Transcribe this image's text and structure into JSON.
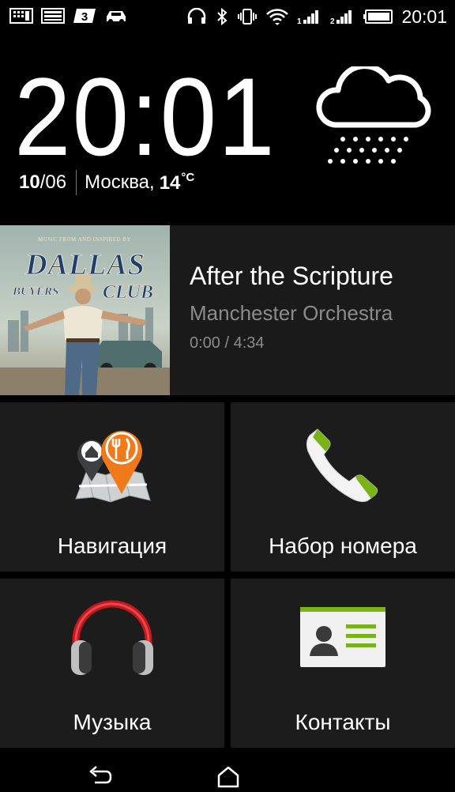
{
  "status_bar": {
    "left_icons": [
      "gallery-notification-icon",
      "image-notification-icon",
      "3g-app-icon",
      "car-mode-icon"
    ],
    "right_icons": [
      "headset-icon",
      "bluetooth-icon",
      "vibrate-icon",
      "wifi-icon",
      "signal-1-icon",
      "signal-2-icon",
      "battery-icon"
    ],
    "time": "20:01"
  },
  "clock_widget": {
    "time": "20:01",
    "date_day": "10",
    "date_rest": "/06",
    "city": "Москва,",
    "temperature": "14",
    "temp_unit": "°C",
    "weather_icon": "rain-cloud-icon"
  },
  "music": {
    "album_art": {
      "line1": "MUSIC FROM AND INSPIRED BY",
      "line2": "DALLAS",
      "line3": "BUYERS",
      "line4": "CLUB"
    },
    "title": "After the Scripture",
    "artist": "Manchester Orchestra",
    "progress_text": "0:00 / 4:34",
    "progress_fraction": 0
  },
  "tiles": [
    {
      "label": "Навигация",
      "icon": "map-pins-icon"
    },
    {
      "label": "Набор номера",
      "icon": "phone-icon"
    },
    {
      "label": "Музыка",
      "icon": "headphones-icon"
    },
    {
      "label": "Контакты",
      "icon": "contact-card-icon"
    }
  ],
  "nav_bar": {
    "buttons": [
      "back-icon",
      "home-icon"
    ]
  },
  "colors": {
    "background": "#000000",
    "tile": "#1c1c1c",
    "secondary_text": "#8b8b8b",
    "accent_orange": "#f07a1a",
    "accent_green": "#7ab317",
    "headphone_red": "#c8161d"
  }
}
